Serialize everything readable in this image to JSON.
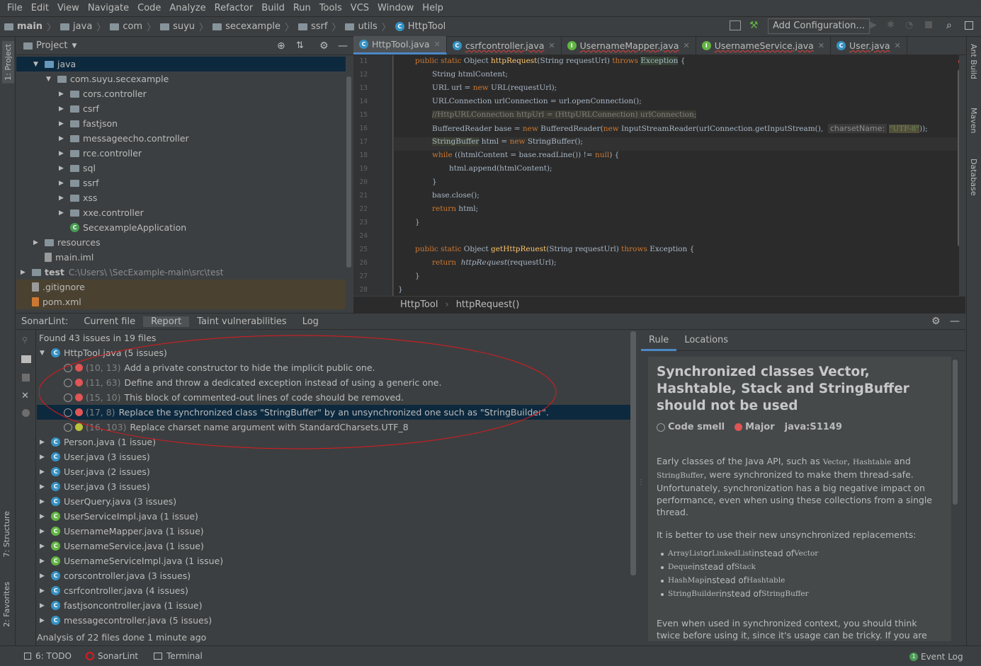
{
  "menu": [
    "File",
    "Edit",
    "View",
    "Navigate",
    "Code",
    "Analyze",
    "Refactor",
    "Build",
    "Run",
    "Tools",
    "VCS",
    "Window",
    "Help"
  ],
  "breadcrumbs": [
    "main",
    "java",
    "com",
    "suyu",
    "secexample",
    "ssrf",
    "utils",
    "HttpTool"
  ],
  "toolbar": {
    "add_config": "Add Configuration..."
  },
  "project": {
    "title": "Project",
    "tree": [
      {
        "label": "java",
        "indent": 1,
        "arrow": "▼",
        "icon": "folder-blue",
        "sel": true
      },
      {
        "label": "com.suyu.secexample",
        "indent": 2,
        "arrow": "▼",
        "icon": "package"
      },
      {
        "label": "cors.controller",
        "indent": 3,
        "arrow": "▶",
        "icon": "package"
      },
      {
        "label": "csrf",
        "indent": 3,
        "arrow": "▶",
        "icon": "package"
      },
      {
        "label": "fastjson",
        "indent": 3,
        "arrow": "▶",
        "icon": "package"
      },
      {
        "label": "messageecho.controller",
        "indent": 3,
        "arrow": "▶",
        "icon": "package"
      },
      {
        "label": "rce.controller",
        "indent": 3,
        "arrow": "▶",
        "icon": "package"
      },
      {
        "label": "sql",
        "indent": 3,
        "arrow": "▶",
        "icon": "package"
      },
      {
        "label": "ssrf",
        "indent": 3,
        "arrow": "▶",
        "icon": "package"
      },
      {
        "label": "xss",
        "indent": 3,
        "arrow": "▶",
        "icon": "package"
      },
      {
        "label": "xxe.controller",
        "indent": 3,
        "arrow": "▶",
        "icon": "package"
      },
      {
        "label": "SecexampleApplication",
        "indent": 3,
        "arrow": "",
        "icon": "spring-class"
      },
      {
        "label": "resources",
        "indent": 1,
        "arrow": "▶",
        "icon": "folder"
      },
      {
        "label": "main.iml",
        "indent": 1,
        "arrow": "",
        "icon": "file"
      },
      {
        "label": "test",
        "indent": 0,
        "arrow": "▶",
        "icon": "folder",
        "path": "C:\\Users\\          \\SecExample-main\\src\\test"
      },
      {
        "label": ".gitignore",
        "indent": 0,
        "arrow": "",
        "icon": "file"
      },
      {
        "label": "pom.xml",
        "indent": 0,
        "arrow": "",
        "icon": "xml"
      }
    ]
  },
  "editor": {
    "tabs": [
      {
        "label": "HttpTool.java",
        "active": true
      },
      {
        "label": "csrfcontroller.java"
      },
      {
        "label": "UsernameMapper.java"
      },
      {
        "label": "UsernameService.java"
      },
      {
        "label": "User.java"
      }
    ],
    "lines": [
      11,
      12,
      13,
      14,
      15,
      16,
      17,
      18,
      19,
      20,
      21,
      22,
      23,
      24,
      25,
      26,
      27,
      28
    ],
    "crumb": [
      "HttpTool",
      "httpRequest()"
    ]
  },
  "sonar": {
    "tabs": [
      "SonarLint:",
      "Current file",
      "Report",
      "Taint vulnerabilities",
      "Log"
    ],
    "summary": "Found 43 issues in 19 files",
    "file": {
      "name": "HttpTool.java",
      "count": "(5 issues)"
    },
    "issues": [
      {
        "loc": "(10, 13)",
        "text": "Add a private constructor to hide the implicit public one.",
        "sev": "major"
      },
      {
        "loc": "(11, 63)",
        "text": "Define and throw a dedicated exception instead of using a generic one.",
        "sev": "major"
      },
      {
        "loc": "(15, 10)",
        "text": "This block of commented-out lines of code should be removed.",
        "sev": "major"
      },
      {
        "loc": "(17, 8)",
        "text": "Replace the synchronized class \"StringBuffer\" by an unsynchronized one such as \"StringBuilder\".",
        "sev": "major",
        "sel": true
      },
      {
        "loc": "(16, 103)",
        "text": "Replace charset name argument with StandardCharsets.UTF_8",
        "sev": "minor"
      }
    ],
    "files": [
      {
        "name": "Person.java",
        "count": "(1 issue)"
      },
      {
        "name": "User.java",
        "count": "(3 issues)"
      },
      {
        "name": "User.java",
        "count": "(2 issues)"
      },
      {
        "name": "User.java",
        "count": "(3 issues)"
      },
      {
        "name": "UserQuery.java",
        "count": "(3 issues)"
      },
      {
        "name": "UserServiceImpl.java",
        "count": "(1 issue)"
      },
      {
        "name": "UsernameMapper.java",
        "count": "(1 issue)"
      },
      {
        "name": "UsernameService.java",
        "count": "(1 issue)"
      },
      {
        "name": "UsernameServiceImpl.java",
        "count": "(1 issue)"
      },
      {
        "name": "corscontroller.java",
        "count": "(3 issues)"
      },
      {
        "name": "csrfcontroller.java",
        "count": "(4 issues)"
      },
      {
        "name": "fastjsoncontroller.java",
        "count": "(1 issue)"
      },
      {
        "name": "messagecontroller.java",
        "count": "(5 issues)"
      }
    ],
    "analysis": "Analysis of 22 files done 1 minute ago"
  },
  "rule": {
    "tabs": [
      "Rule",
      "Locations"
    ],
    "title": "Synchronized classes Vector, Hashtable, Stack and StringBuffer should not be used",
    "type": "Code smell",
    "severity": "Major",
    "key": "java:S1149",
    "p1a": "Early classes of the Java API, such as ",
    "v": "Vector",
    "c1": ", ",
    "h": "Hashtable",
    "c2": " and",
    "sb": "StringBuffer",
    "p1b": ", were synchronized to make them thread-safe. Unfortunately, synchronization has a big negative impact on performance, even when using these collections from a single thread.",
    "p2": "It is better to use their new unsynchronized replacements:",
    "bullets": [
      {
        "a": "ArrayList",
        "m": " or ",
        "b": "LinkedList",
        "n": " instead of ",
        "c": "Vector"
      },
      {
        "a": "Deque",
        "m": " instead of ",
        "b": "Stack",
        "n": "",
        "c": ""
      },
      {
        "a": "HashMap",
        "m": " instead of ",
        "b": "Hashtable",
        "n": "",
        "c": ""
      },
      {
        "a": "StringBuilder",
        "m": " instead of ",
        "b": "StringBuffer",
        "n": "",
        "c": ""
      }
    ],
    "p3": "Even when used in synchronized context, you should think twice before using it, since it's usage can be tricky. If you are confident the usage is legitimate, you can safely ignore this warning."
  },
  "sidebar": {
    "left": [
      "1: Project",
      "7: Structure",
      "2: Favorites"
    ],
    "right": [
      "Ant Build",
      "Maven",
      "Database"
    ]
  },
  "status": {
    "todo": "6: TODO",
    "sonar": "SonarLint",
    "terminal": "Terminal",
    "event": "Event Log",
    "event_count": "1"
  },
  "colors": {
    "accent": "#4a88c7",
    "selection": "#0d293e",
    "annotation": "#e0191e"
  }
}
